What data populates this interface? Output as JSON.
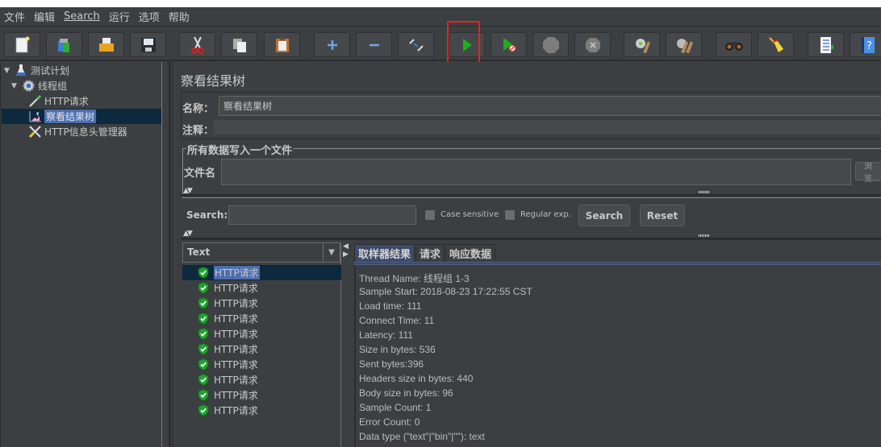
{
  "menubar": {
    "items": [
      "文件",
      "编辑",
      "Search",
      "运行",
      "选项",
      "帮助"
    ]
  },
  "toolbar": {
    "buttons": [
      {
        "name": "new",
        "icon": "new-file-icon"
      },
      {
        "name": "templates",
        "icon": "templates-icon"
      },
      {
        "name": "open",
        "icon": "open-folder-icon"
      },
      {
        "name": "save",
        "icon": "save-icon"
      },
      {
        "name": "cut",
        "icon": "scissors-icon"
      },
      {
        "name": "copy",
        "icon": "copy-icon"
      },
      {
        "name": "paste",
        "icon": "paste-icon"
      },
      {
        "name": "expand",
        "icon": "plus-icon"
      },
      {
        "name": "collapse",
        "icon": "minus-icon"
      },
      {
        "name": "toggle",
        "icon": "toggle-icon"
      },
      {
        "name": "start",
        "icon": "play-icon"
      },
      {
        "name": "start-no-pauses",
        "icon": "play-no-timers-icon"
      },
      {
        "name": "stop",
        "icon": "stop-icon"
      },
      {
        "name": "shutdown",
        "icon": "shutdown-icon"
      },
      {
        "name": "clear",
        "icon": "clear-icon"
      },
      {
        "name": "clear-all",
        "icon": "clear-all-icon"
      },
      {
        "name": "search",
        "icon": "binoculars-icon"
      },
      {
        "name": "reset-search",
        "icon": "broom-icon"
      },
      {
        "name": "function-helper",
        "icon": "function-list-icon"
      },
      {
        "name": "help",
        "icon": "help-book-icon"
      }
    ],
    "highlighted": "start"
  },
  "tree": {
    "nodes": [
      {
        "label": "测试计划",
        "level": 0,
        "expanded": true,
        "icon": "flask-icon"
      },
      {
        "label": "线程组",
        "level": 1,
        "expanded": true,
        "icon": "gear-icon"
      },
      {
        "label": "HTTP请求",
        "level": 2,
        "icon": "pipette-icon"
      },
      {
        "label": "察看结果树",
        "level": 2,
        "icon": "results-tree-icon",
        "selected": true
      },
      {
        "label": "HTTP信息头管理器",
        "level": 2,
        "icon": "wrench-icon"
      }
    ]
  },
  "main": {
    "title": "察看结果树",
    "name_label": "名称：",
    "name_value": "察看结果树",
    "comment_label": "注释：",
    "comment_value": "",
    "file_group_title": "所有数据写入一个文件",
    "filename_label": "文件名",
    "filename_value": "",
    "browse_label": "浏览..."
  },
  "search": {
    "label": "Search:",
    "value": "",
    "case_sensitive_label": "Case sensitive",
    "case_sensitive": false,
    "regex_label": "Regular exp.",
    "regex": false,
    "search_button": "Search",
    "reset_button": "Reset"
  },
  "results": {
    "renderer": "Text",
    "items": [
      "HTTP请求",
      "HTTP请求",
      "HTTP请求",
      "HTTP请求",
      "HTTP请求",
      "HTTP请求",
      "HTTP请求",
      "HTTP请求",
      "HTTP请求",
      "HTTP请求"
    ],
    "selected_index": 0
  },
  "tabs": {
    "items": [
      "取样器结果",
      "请求",
      "响应数据"
    ],
    "active": 0
  },
  "sampler_result": {
    "lines": [
      "Thread Name: 线程组 1-3",
      "Sample Start: 2018-08-23 17:22:55 CST",
      "Load time: 111",
      "Connect Time: 11",
      "Latency: 111",
      "Size in bytes: 536",
      "Sent bytes:396",
      "Headers size in bytes: 440",
      "Body size in bytes: 96",
      "Sample Count: 1",
      "Error Count: 0",
      "Data type (\"text\"|\"bin\"|\"\"): text"
    ]
  },
  "colors": {
    "background": "#3c3f41",
    "selection": "#4b6eaf",
    "selected_row": "#0d293e",
    "active_tab": "#3c4b69",
    "highlight_box": "#e8231f",
    "success": "#1fa22e"
  }
}
